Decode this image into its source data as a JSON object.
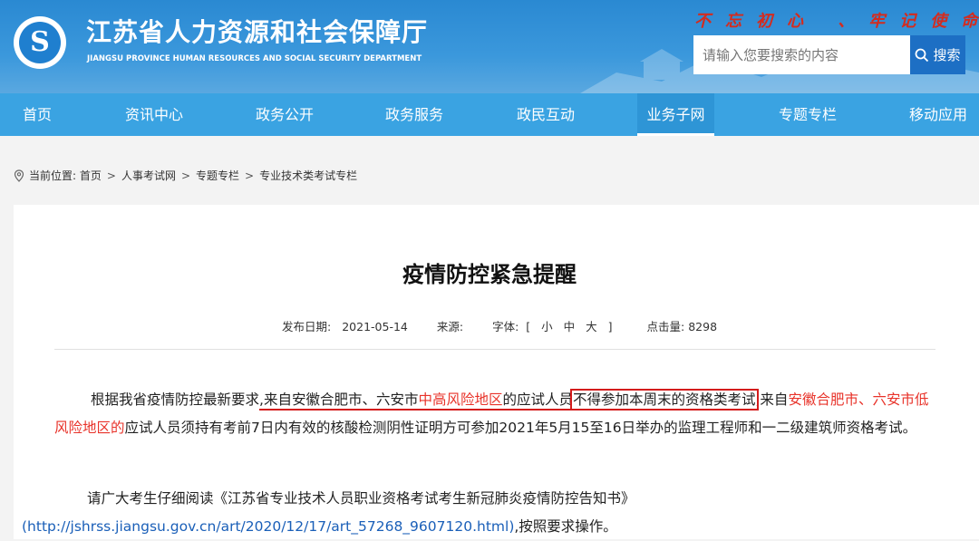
{
  "header": {
    "title": "江苏省人力资源和社会保障厅",
    "subtitle": "JIANGSU PROVINCE HUMAN RESOURCES AND SOCIAL SECURITY DEPARTMENT",
    "slogan": "不忘初心 、牢记使命",
    "search_placeholder": "请输入您要搜索的内容",
    "search_button": "搜索"
  },
  "nav": {
    "items": [
      {
        "label": "首页"
      },
      {
        "label": "资讯中心"
      },
      {
        "label": "政务公开"
      },
      {
        "label": "政务服务"
      },
      {
        "label": "政民互动"
      },
      {
        "label": "业务子网",
        "active": true
      },
      {
        "label": "专题专栏"
      },
      {
        "label": "移动应用"
      }
    ]
  },
  "breadcrumb": {
    "prefix": "当前位置:",
    "items": [
      "首页",
      "人事考试网",
      "专题专栏",
      "专业技术类考试专栏"
    ],
    "separator": ">"
  },
  "article": {
    "title": "疫情防控紧急提醒",
    "date_label": "发布日期:",
    "date": "2021-05-14",
    "source_label": "来源:",
    "font_label": "字体:",
    "font_open": "[",
    "font_small": "小",
    "font_medium": "中",
    "font_large": "大",
    "font_close": "]",
    "hits_label": "点击量:",
    "hits": "8298",
    "p1": {
      "a": "根据我省疫情防控最新要求",
      "b": ",来自安徽合肥市、六安市",
      "c": "中高风险地区",
      "d": "的应试人员",
      "e": "不得参加本周末的资格类考试",
      "f": ",来自",
      "g": "安徽合肥市、六安市低风险地区的",
      "h": "应试人员须持有考前7日内有效的核酸检测阴性证明方可参加2021年5月15至16日举办的监理工程师和一二级建筑师资格考试。"
    },
    "p2": {
      "a": "请广大考生仔细阅读《江苏省专业技术人员职业资格考试考生新冠肺炎疫情防控告知书》",
      "link": "(http://jshrss.jiangsu.gov.cn/art/2020/12/17/art_57268_9607120.html)",
      "b": ",按照要求操作。"
    }
  },
  "colors": {
    "header_blue": "#2a89d2",
    "nav_blue": "#3aa3e2",
    "alert_red": "#e8332a",
    "slogan_red": "#d42b1e"
  },
  "icons": [
    "logo-icon",
    "search-icon",
    "location-pin-icon"
  ]
}
